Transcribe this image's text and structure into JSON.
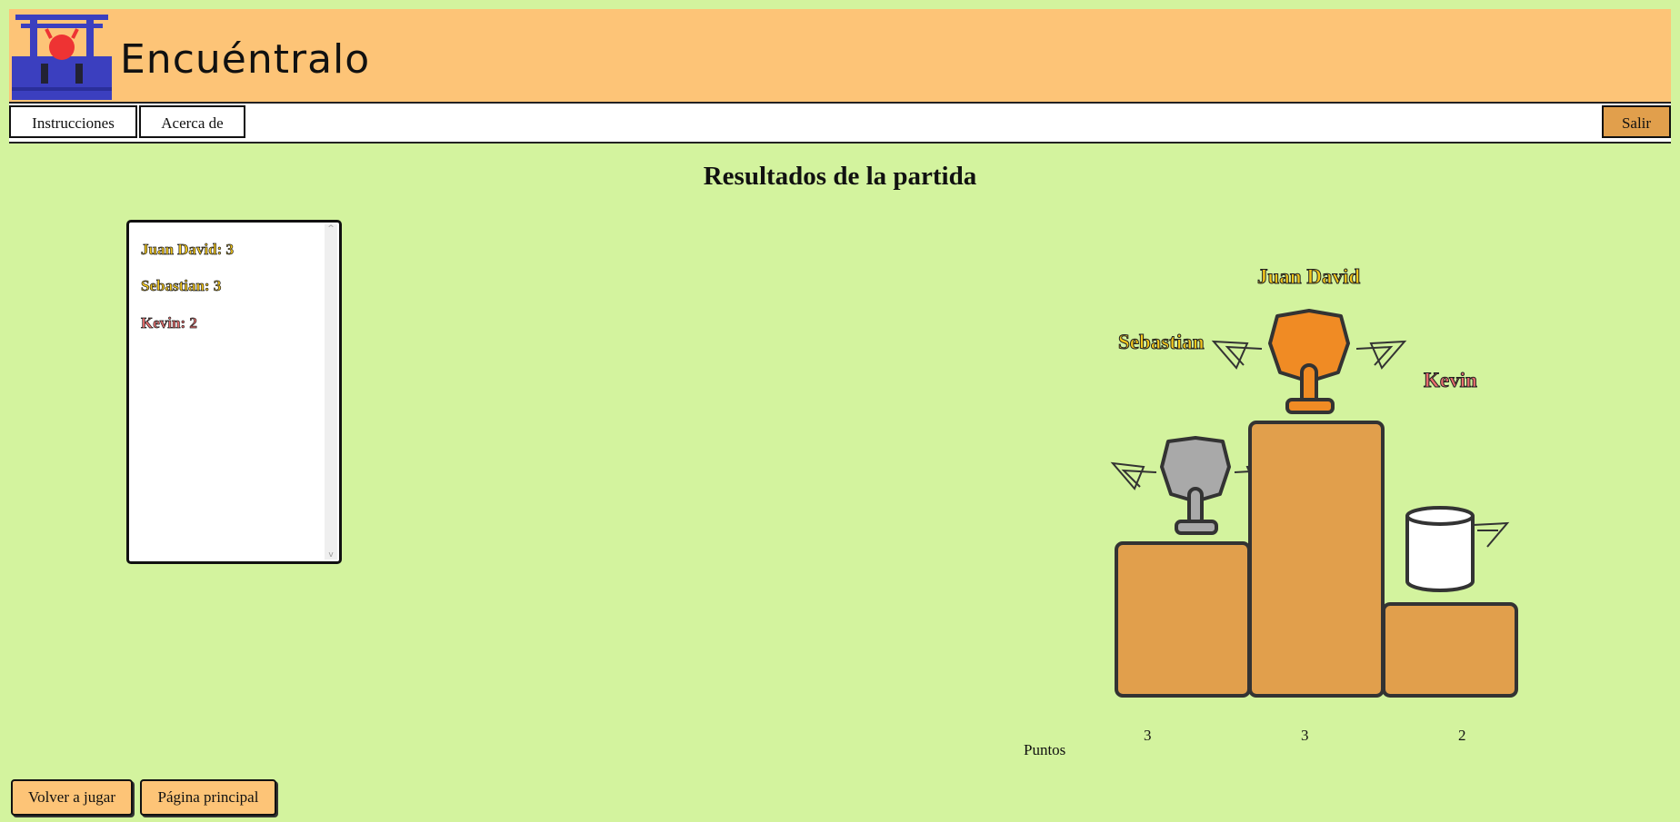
{
  "app": {
    "title": "Encuéntralo"
  },
  "nav": {
    "instructions": "Instrucciones",
    "about": "Acerca de",
    "exit": "Salir"
  },
  "page": {
    "title": "Resultados de la partida"
  },
  "scores": [
    {
      "label": "Juan David: 3",
      "color": "gold"
    },
    {
      "label": "Sebastian: 3",
      "color": "gold"
    },
    {
      "label": "Kevin: 2",
      "color": "red"
    }
  ],
  "podium": {
    "first": {
      "name": "Juan David",
      "points": "3"
    },
    "second": {
      "name": "Sebastian",
      "points": "3"
    },
    "third": {
      "name": "Kevin",
      "points": "2"
    },
    "points_label": "Puntos"
  },
  "actions": {
    "play_again": "Volver a jugar",
    "main_page": "Página principal"
  },
  "colors": {
    "header": "#fdc477",
    "background": "#d3f39e",
    "podium": "#e19f4c",
    "gold_trophy": "#f08b24",
    "silver_trophy": "#a9a9a9"
  }
}
